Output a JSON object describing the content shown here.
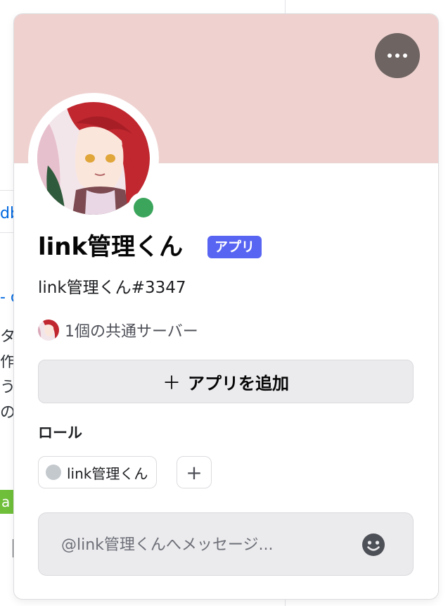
{
  "colors": {
    "banner": "#efd2d0",
    "status_online": "#3ba55c",
    "badge": "#5865f2",
    "button_bg": "#ebebed"
  },
  "background_fragments": {
    "frag1": "db",
    "frag2": "- c",
    "frag3": "タ",
    "frag4": "作",
    "frag5": "う",
    "frag6": "の",
    "frag7": "a",
    "frag8": "【"
  },
  "profile": {
    "display_name": "link管理くん",
    "badge": "アプリ",
    "username": "link管理くん#3347",
    "status": "online",
    "mutual_servers": "1個の共通サーバー"
  },
  "actions": {
    "add_app_icon": "plus-icon",
    "add_app_label": "アプリを追加",
    "more_icon": "ellipsis-icon"
  },
  "roles": {
    "heading": "ロール",
    "items": [
      {
        "name": "link管理くん",
        "color": "#c4c9ce"
      }
    ],
    "add_icon": "plus-icon"
  },
  "message": {
    "placeholder": "@link管理くんへメッセージ...",
    "emoji_icon": "smiley-icon"
  }
}
